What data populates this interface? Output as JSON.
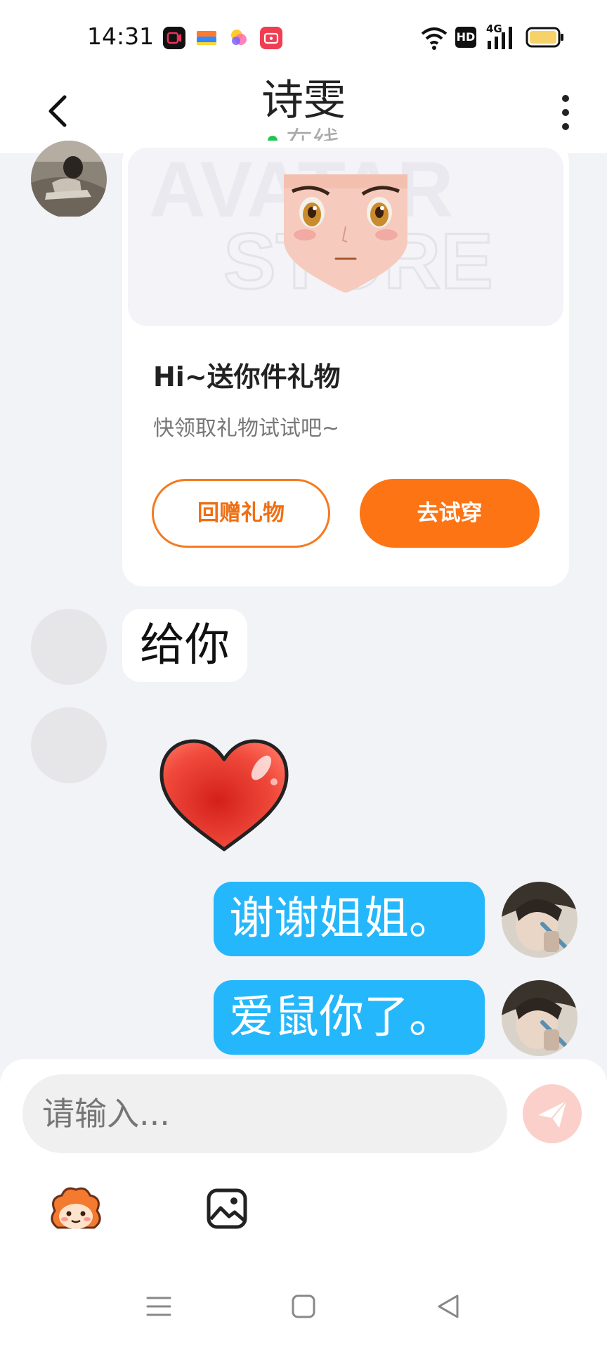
{
  "status_bar": {
    "time": "14:31",
    "hd_label": "HD",
    "network_label": "4G",
    "notification_icons": [
      "video-recorder-icon",
      "wallet-icon",
      "colorful-app-icon",
      "video-app-icon"
    ],
    "battery_color": "#f7d26a"
  },
  "header": {
    "title": "诗雯",
    "status": "在线",
    "status_color": "#23c552"
  },
  "gift_card": {
    "title": "Hi~送你件礼物",
    "subtitle": "快领取礼物试试吧~",
    "return_gift_label": "回赠礼物",
    "try_on_label": "去试穿",
    "image_watermark": "AVATAR STORE"
  },
  "messages": [
    {
      "side": "left",
      "type": "text",
      "text": "给你"
    },
    {
      "side": "left",
      "type": "sticker",
      "sticker": "heart"
    },
    {
      "side": "right",
      "type": "text",
      "text": "谢谢姐姐。"
    },
    {
      "side": "right",
      "type": "text",
      "text": "爱鼠你了。"
    }
  ],
  "composer": {
    "placeholder": "请输入..."
  },
  "colors": {
    "accent_orange": "#fc7414",
    "my_bubble": "#25b7fb",
    "send_button": "#fbd0ca"
  }
}
